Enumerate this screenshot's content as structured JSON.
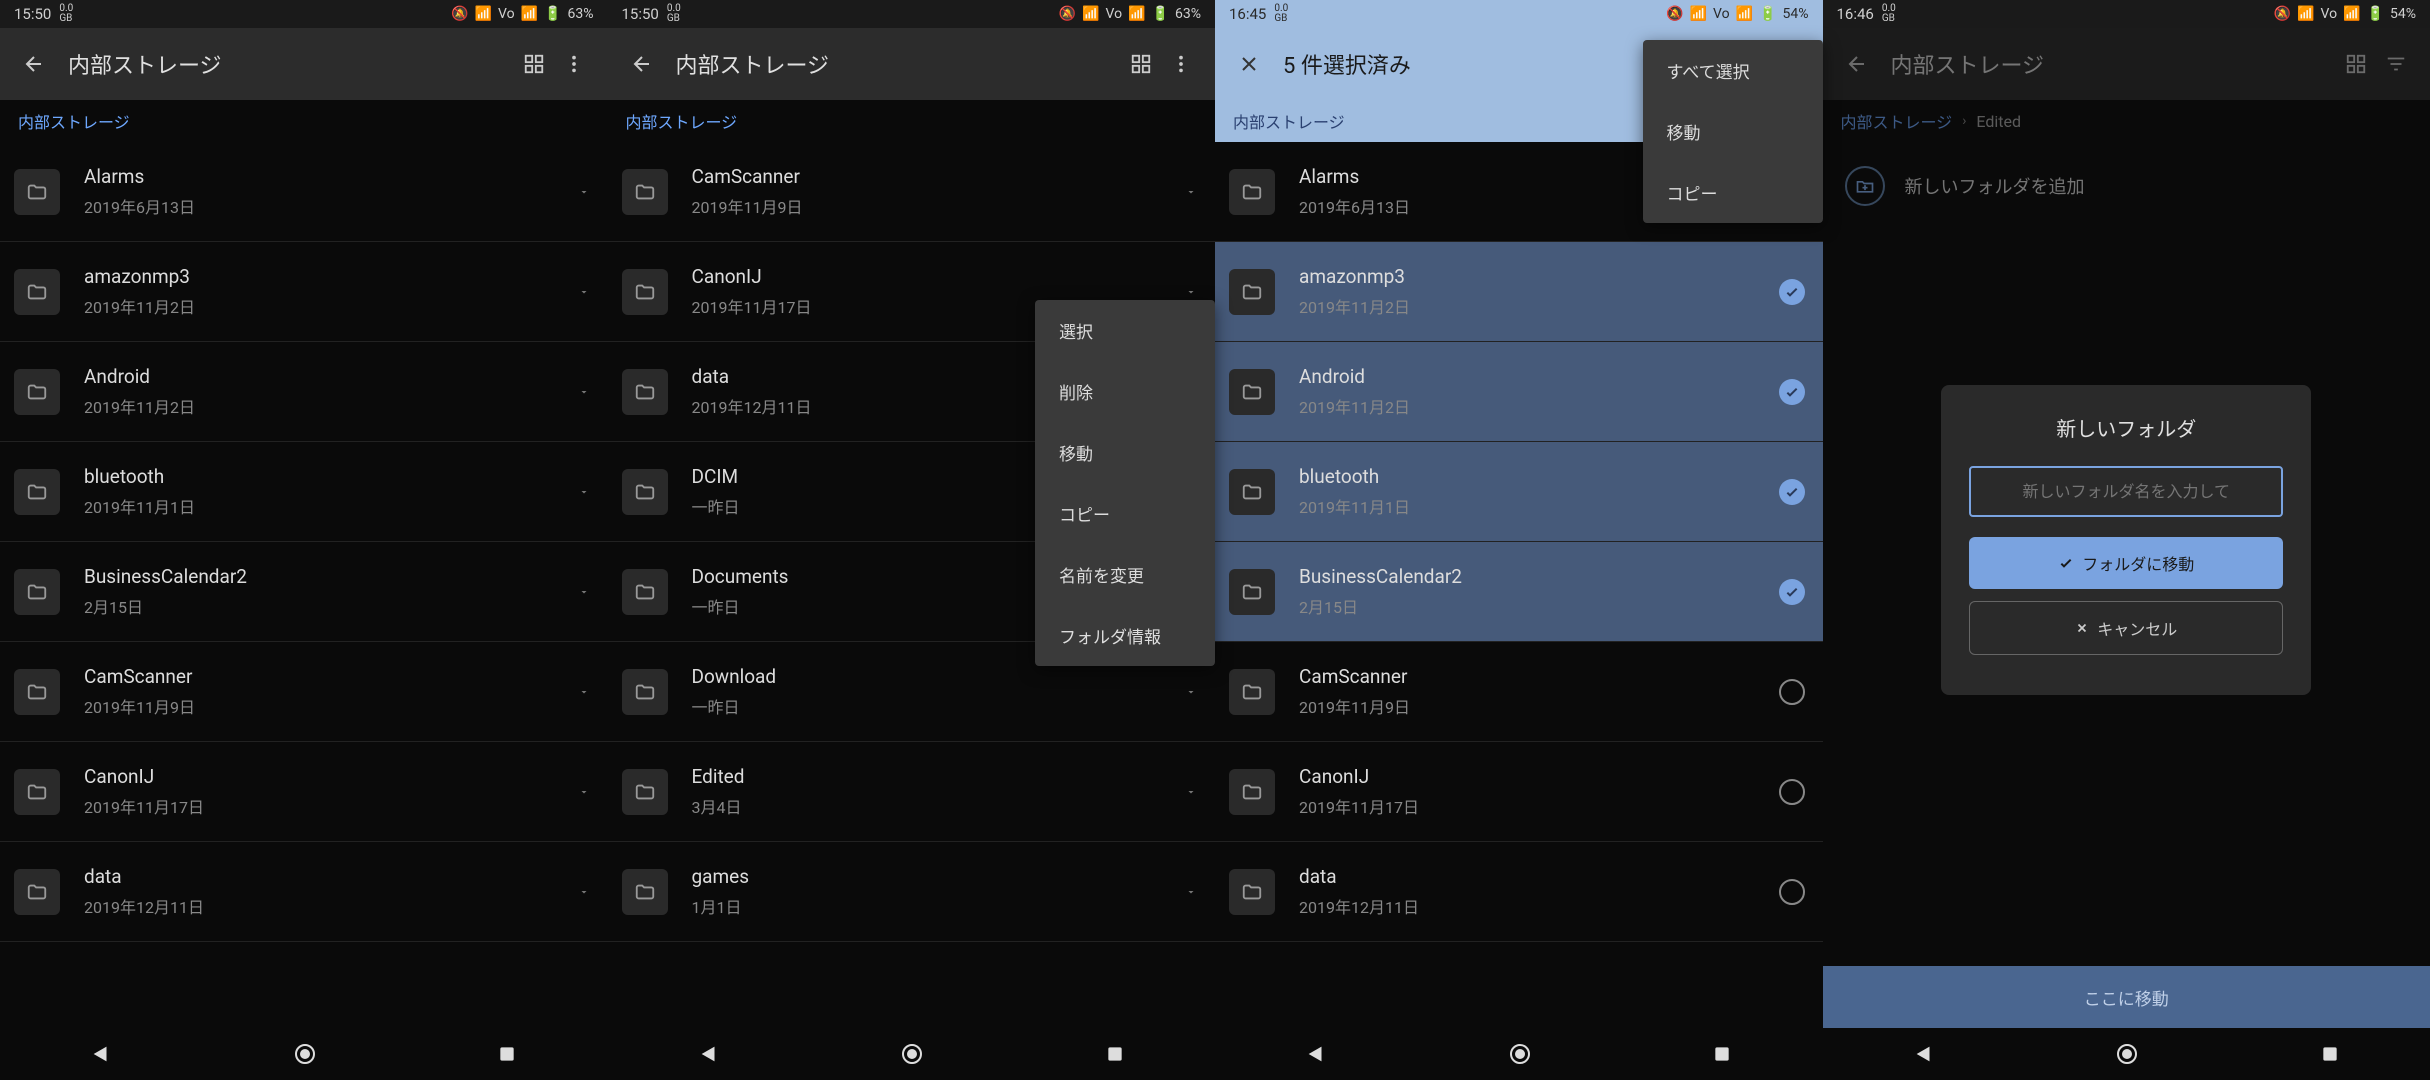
{
  "status": {
    "time1": "15:50",
    "time2": "15:50",
    "time3": "16:45",
    "time4": "16:46",
    "gb": "0.0",
    "gb_unit": "GB",
    "battery1": "63%",
    "battery2": "63%",
    "battery3": "54%",
    "battery4": "54%",
    "net": "Vo"
  },
  "headers": {
    "s1": "内部ストレージ",
    "s2": "内部ストレージ",
    "s3": "5 件選択済み",
    "s4": "内部ストレージ"
  },
  "breadcrumbs": {
    "root": "内部ストレージ",
    "edited": "Edited"
  },
  "folders1": [
    {
      "name": "Alarms",
      "date": "2019年6月13日"
    },
    {
      "name": "amazonmp3",
      "date": "2019年11月2日"
    },
    {
      "name": "Android",
      "date": "2019年11月2日"
    },
    {
      "name": "bluetooth",
      "date": "2019年11月1日"
    },
    {
      "name": "BusinessCalendar2",
      "date": "2月15日"
    },
    {
      "name": "CamScanner",
      "date": "2019年11月9日"
    },
    {
      "name": "CanonIJ",
      "date": "2019年11月17日"
    },
    {
      "name": "data",
      "date": "2019年12月11日"
    }
  ],
  "folders2": [
    {
      "name": "CamScanner",
      "date": "2019年11月9日"
    },
    {
      "name": "CanonIJ",
      "date": "2019年11月17日"
    },
    {
      "name": "data",
      "date": "2019年12月11日"
    },
    {
      "name": "DCIM",
      "date": "一昨日"
    },
    {
      "name": "Documents",
      "date": "一昨日"
    },
    {
      "name": "Download",
      "date": "一昨日"
    },
    {
      "name": "Edited",
      "date": "3月4日"
    },
    {
      "name": "games",
      "date": "1月1日"
    }
  ],
  "folders3": [
    {
      "name": "Alarms",
      "date": "2019年6月13日",
      "sel": false,
      "show": false
    },
    {
      "name": "amazonmp3",
      "date": "2019年11月2日",
      "sel": true,
      "show": true
    },
    {
      "name": "Android",
      "date": "2019年11月2日",
      "sel": true,
      "show": true
    },
    {
      "name": "bluetooth",
      "date": "2019年11月1日",
      "sel": true,
      "show": true
    },
    {
      "name": "BusinessCalendar2",
      "date": "2月15日",
      "sel": true,
      "show": true
    },
    {
      "name": "CamScanner",
      "date": "2019年11月9日",
      "sel": false,
      "show": true
    },
    {
      "name": "CanonIJ",
      "date": "2019年11月17日",
      "sel": false,
      "show": true
    },
    {
      "name": "data",
      "date": "2019年12月11日",
      "sel": false,
      "show": true
    }
  ],
  "context_menu2": [
    "選択",
    "削除",
    "移動",
    "コピー",
    "名前を変更",
    "フォルダ情報"
  ],
  "context_menu3": [
    "すべて選択",
    "移動",
    "コピー"
  ],
  "add_folder": "新しいフォルダを追加",
  "dialog": {
    "title": "新しいフォルダ",
    "placeholder": "新しいフォルダ名を入力して",
    "confirm": "フォルダに移動",
    "cancel": "キャンセル"
  },
  "bottom_action": "ここに移動"
}
